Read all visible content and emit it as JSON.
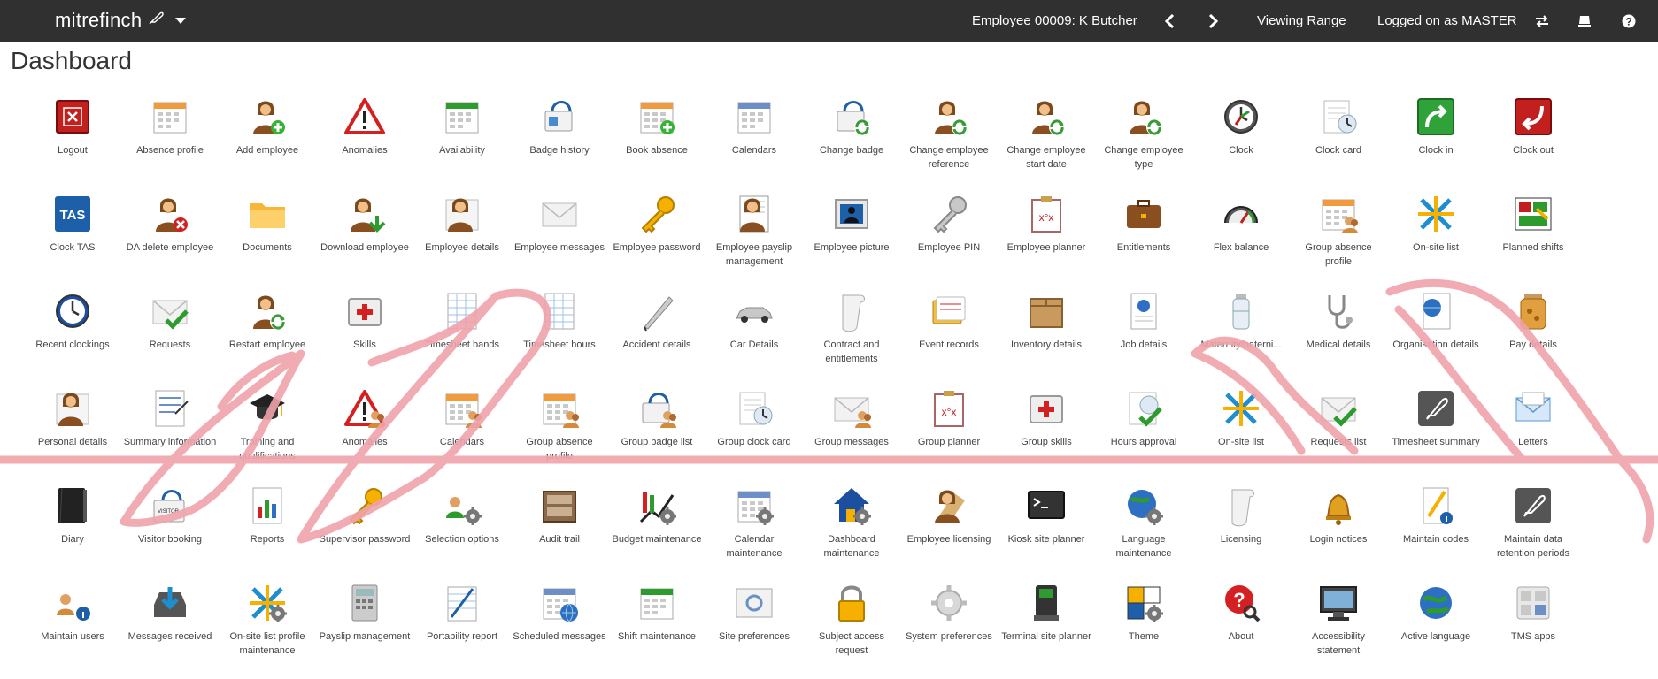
{
  "app": {
    "brand": "mitrefinch"
  },
  "header": {
    "employee": "Employee 00009: K Butcher",
    "viewing_range": "Viewing Range",
    "logged_on": "Logged on as MASTER"
  },
  "page": {
    "title": "Dashboard"
  },
  "colors": {
    "topbar": "#303030",
    "watermark": "#f0a3aa"
  },
  "tiles": [
    {
      "label": "Logout",
      "icon": "logout"
    },
    {
      "label": "Absence profile",
      "icon": "calendar-orange"
    },
    {
      "label": "Add employee",
      "icon": "person-add"
    },
    {
      "label": "Anomalies",
      "icon": "warning"
    },
    {
      "label": "Availability",
      "icon": "calendar-green"
    },
    {
      "label": "Badge history",
      "icon": "badge"
    },
    {
      "label": "Book absence",
      "icon": "calendar-add"
    },
    {
      "label": "Calendars",
      "icon": "calendar-blue"
    },
    {
      "label": "Change badge",
      "icon": "badge-recycle"
    },
    {
      "label": "Change employee reference",
      "icon": "person-recycle"
    },
    {
      "label": "Change employee start date",
      "icon": "person-recycle"
    },
    {
      "label": "Change employee type",
      "icon": "person-recycle"
    },
    {
      "label": "Clock",
      "icon": "clock-dark"
    },
    {
      "label": "Clock card",
      "icon": "clock-card"
    },
    {
      "label": "Clock in",
      "icon": "clock-in"
    },
    {
      "label": "Clock out",
      "icon": "clock-out"
    },
    {
      "label": "Clock TAS",
      "icon": "tas"
    },
    {
      "label": "DA delete employee",
      "icon": "person-delete"
    },
    {
      "label": "Documents",
      "icon": "folder"
    },
    {
      "label": "Download employee",
      "icon": "person-download"
    },
    {
      "label": "Employee details",
      "icon": "person-doc"
    },
    {
      "label": "Employee messages",
      "icon": "envelope"
    },
    {
      "label": "Employee password",
      "icon": "key"
    },
    {
      "label": "Employee payslip management",
      "icon": "payslip"
    },
    {
      "label": "Employee picture",
      "icon": "picture"
    },
    {
      "label": "Employee PIN",
      "icon": "key-grey"
    },
    {
      "label": "Employee planner",
      "icon": "planner"
    },
    {
      "label": "Entitlements",
      "icon": "briefcase"
    },
    {
      "label": "Flex balance",
      "icon": "gauge"
    },
    {
      "label": "Group absence profile",
      "icon": "calendar-group"
    },
    {
      "label": "On-site list",
      "icon": "arrows"
    },
    {
      "label": "Planned shifts",
      "icon": "shifts"
    },
    {
      "label": "Recent clockings",
      "icon": "clock-blue"
    },
    {
      "label": "Requests",
      "icon": "envelope-check"
    },
    {
      "label": "Restart employee",
      "icon": "person-recycle"
    },
    {
      "label": "Skills",
      "icon": "first-aid"
    },
    {
      "label": "Timesheet bands",
      "icon": "sheet"
    },
    {
      "label": "Timesheet hours",
      "icon": "sheet"
    },
    {
      "label": "Accident details",
      "icon": "pen"
    },
    {
      "label": "Car Details",
      "icon": "car"
    },
    {
      "label": "Contract and entitlements",
      "icon": "scroll"
    },
    {
      "label": "Event records",
      "icon": "cards"
    },
    {
      "label": "Inventory details",
      "icon": "box"
    },
    {
      "label": "Job details",
      "icon": "doc-globe"
    },
    {
      "label": "Maternity/paterni...",
      "icon": "bottle"
    },
    {
      "label": "Medical details",
      "icon": "stethoscope"
    },
    {
      "label": "Organisation details",
      "icon": "globe-doc"
    },
    {
      "label": "Pay details",
      "icon": "jar"
    },
    {
      "label": "Personal details",
      "icon": "person-doc"
    },
    {
      "label": "Summary information",
      "icon": "summary"
    },
    {
      "label": "Training and qualifications",
      "icon": "grad-cap"
    },
    {
      "label": "Anomalies",
      "icon": "warning-group"
    },
    {
      "label": "Calendars",
      "icon": "calendar-group"
    },
    {
      "label": "Group absence profile",
      "icon": "calendar-group"
    },
    {
      "label": "Group badge list",
      "icon": "badge-group"
    },
    {
      "label": "Group clock card",
      "icon": "clock-card"
    },
    {
      "label": "Group messages",
      "icon": "envelope-group"
    },
    {
      "label": "Group planner",
      "icon": "planner"
    },
    {
      "label": "Group skills",
      "icon": "first-aid"
    },
    {
      "label": "Hours approval",
      "icon": "check-clock"
    },
    {
      "label": "On-site list",
      "icon": "arrows"
    },
    {
      "label": "Requests list",
      "icon": "envelope-check"
    },
    {
      "label": "Timesheet summary",
      "icon": "feather-tile"
    },
    {
      "label": "Letters",
      "icon": "envelope-blue"
    },
    {
      "label": "Diary",
      "icon": "diary"
    },
    {
      "label": "Visitor booking",
      "icon": "visitor"
    },
    {
      "label": "Reports",
      "icon": "report"
    },
    {
      "label": "Supervisor password",
      "icon": "key"
    },
    {
      "label": "Selection options",
      "icon": "people-gear"
    },
    {
      "label": "Audit trail",
      "icon": "filebox"
    },
    {
      "label": "Budget maintenance",
      "icon": "budget"
    },
    {
      "label": "Calendar maintenance",
      "icon": "calendar-gear"
    },
    {
      "label": "Dashboard maintenance",
      "icon": "house-gear"
    },
    {
      "label": "Employee licensing",
      "icon": "person-scroll"
    },
    {
      "label": "Kiosk site planner",
      "icon": "terminal"
    },
    {
      "label": "Language maintenance",
      "icon": "globe-gear"
    },
    {
      "label": "Licensing",
      "icon": "scroll"
    },
    {
      "label": "Login notices",
      "icon": "bell"
    },
    {
      "label": "Maintain codes",
      "icon": "pencil-info"
    },
    {
      "label": "Maintain data retention periods",
      "icon": "feather-tile"
    },
    {
      "label": "Maintain users",
      "icon": "people-info"
    },
    {
      "label": "Messages received",
      "icon": "inbox"
    },
    {
      "label": "On-site list profile maintenance",
      "icon": "arrows-gear"
    },
    {
      "label": "Payslip management",
      "icon": "calculator"
    },
    {
      "label": "Portability report",
      "icon": "notebook"
    },
    {
      "label": "Scheduled messages",
      "icon": "calendar-globe"
    },
    {
      "label": "Shift maintenance",
      "icon": "calendar-green"
    },
    {
      "label": "Site preferences",
      "icon": "settings-window"
    },
    {
      "label": "Subject access request",
      "icon": "padlock"
    },
    {
      "label": "System preferences",
      "icon": "gear-grey"
    },
    {
      "label": "Terminal site planner",
      "icon": "terminal-device"
    },
    {
      "label": "Theme",
      "icon": "theme"
    },
    {
      "label": "About",
      "icon": "about"
    },
    {
      "label": "Accessibility statement",
      "icon": "monitor"
    },
    {
      "label": "Active language",
      "icon": "globe"
    },
    {
      "label": "TMS apps",
      "icon": "apps"
    }
  ]
}
